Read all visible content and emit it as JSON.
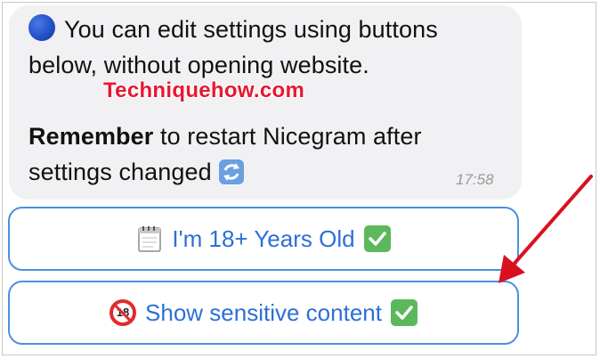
{
  "message": {
    "line1": "You can edit settings using buttons",
    "line2": "below, without opening website.",
    "remember_bold": "Remember",
    "line3_rest": " to restart Nicegram after",
    "line4": "settings changed",
    "time": "17:58"
  },
  "watermark": "Techniquehow.com",
  "buttons": [
    {
      "label": "I'm 18+ Years Old",
      "leading_icon": "calendar-icon",
      "trailing_icon": "check-mark-icon"
    },
    {
      "label": "Show sensitive content",
      "leading_icon": "no-under-18-icon",
      "trailing_icon": "check-mark-icon"
    }
  ],
  "colors": {
    "accent": "#2d6fd8",
    "button_border": "#4a8fe0",
    "watermark": "#e8172f",
    "arrow": "#d9111f",
    "check": "#5cb85c"
  }
}
